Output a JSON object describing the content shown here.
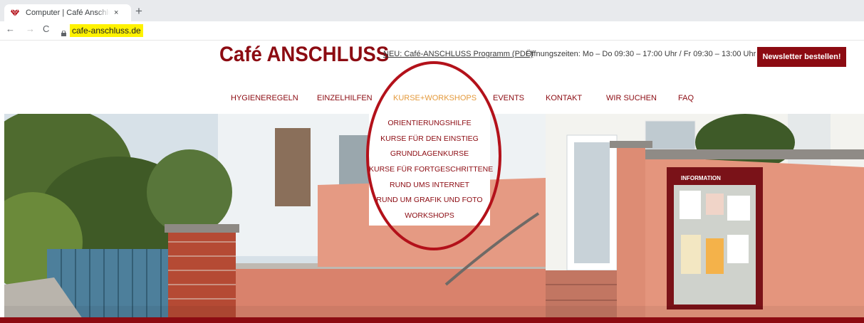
{
  "browser": {
    "tab_title": "Computer | Café Anschluss Frankfurt",
    "close_glyph": "×",
    "new_tab_glyph": "+",
    "back_glyph": "←",
    "forward_glyph": "→",
    "reload_glyph": "C",
    "url": "cafe-anschluss.de",
    "url_highlight_color": "#fff200"
  },
  "header": {
    "logo_text": "Café ANSCHLUSS",
    "programm_link": "NEU: Café-ANSCHLUSS Programm (PDF)",
    "opening_hours": "Öffnungszeiten: Mo – Do 09:30 – 17:00 Uhr / Fr 09:30 – 13:00 Uhr",
    "newsletter_button": "Newsletter bestellen!",
    "brand_color": "#8c0b12"
  },
  "nav": {
    "items": [
      {
        "label": "HYGIENEREGELN"
      },
      {
        "label": "EINZELHILFEN"
      },
      {
        "label": "KURSE+WORKSHOPS",
        "active": true
      },
      {
        "label": "EVENTS"
      },
      {
        "label": "KONTAKT"
      },
      {
        "label": "WIR SUCHEN"
      },
      {
        "label": "FAQ"
      }
    ],
    "active_color": "#e49a3c"
  },
  "dropdown": {
    "items": [
      {
        "label": "ORIENTIERUNGSHILFE"
      },
      {
        "label": "KURSE FÜR DEN EINSTIEG"
      },
      {
        "label": "GRUNDLAGENKURSE"
      },
      {
        "label": "KURSE FÜR FORTGESCHRITTENE"
      },
      {
        "label": "RUND UMS INTERNET"
      },
      {
        "label": "RUND UM GRAFIK UND FOTO"
      },
      {
        "label": "WORKSHOPS"
      }
    ]
  },
  "hero": {
    "board_title": "INFORMATION"
  },
  "annotation": {
    "circle_color": "#b3111a"
  }
}
